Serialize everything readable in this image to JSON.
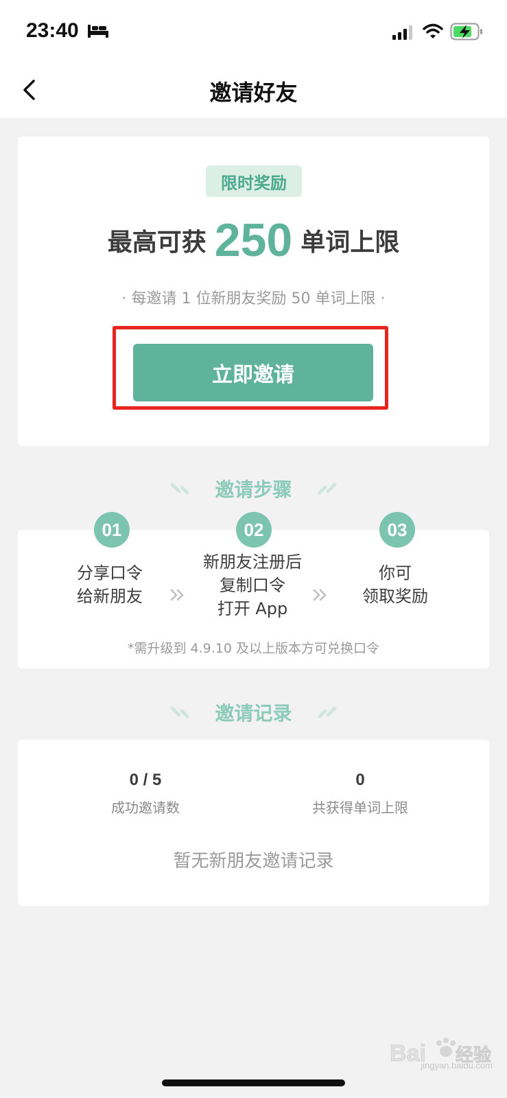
{
  "status_bar": {
    "time": "23:40",
    "icons": [
      "bed-icon",
      "signal-icon",
      "wifi-icon",
      "battery-charging-icon"
    ]
  },
  "nav": {
    "title": "邀请好友",
    "back_icon": "chevron-left-icon"
  },
  "reward": {
    "tag": "限时奖励",
    "headline_prefix": "最高可获",
    "headline_number": "250",
    "headline_suffix": "单词上限",
    "subtext": "· 每邀请 1 位新朋友奖励 50 单词上限 ·",
    "invite_button_label": "立即邀请"
  },
  "steps": {
    "title": "邀请步骤",
    "items": [
      {
        "number": "01",
        "lines": [
          "分享口令",
          "给新朋友"
        ]
      },
      {
        "number": "02",
        "lines": [
          "新朋友注册后",
          "复制口令",
          "打开 App"
        ]
      },
      {
        "number": "03",
        "lines": [
          "你可",
          "领取奖励"
        ]
      }
    ],
    "note": "*需升级到 4.9.10 及以上版本方可兑换口令"
  },
  "records": {
    "title": "邀请记录",
    "stats": [
      {
        "value": "0 / 5",
        "label": "成功邀请数"
      },
      {
        "value": "0",
        "label": "共获得单词上限"
      }
    ],
    "empty_text": "暂无新朋友邀请记录"
  },
  "watermark": {
    "brand": "Bai 经验",
    "url": "jingyan.baidu.com"
  },
  "colors": {
    "accent": "#5fb39a",
    "accent_light": "#dcefe7",
    "section_title": "#8ccbb7",
    "highlight_frame": "#e8241f",
    "background": "#f2f2f2"
  }
}
